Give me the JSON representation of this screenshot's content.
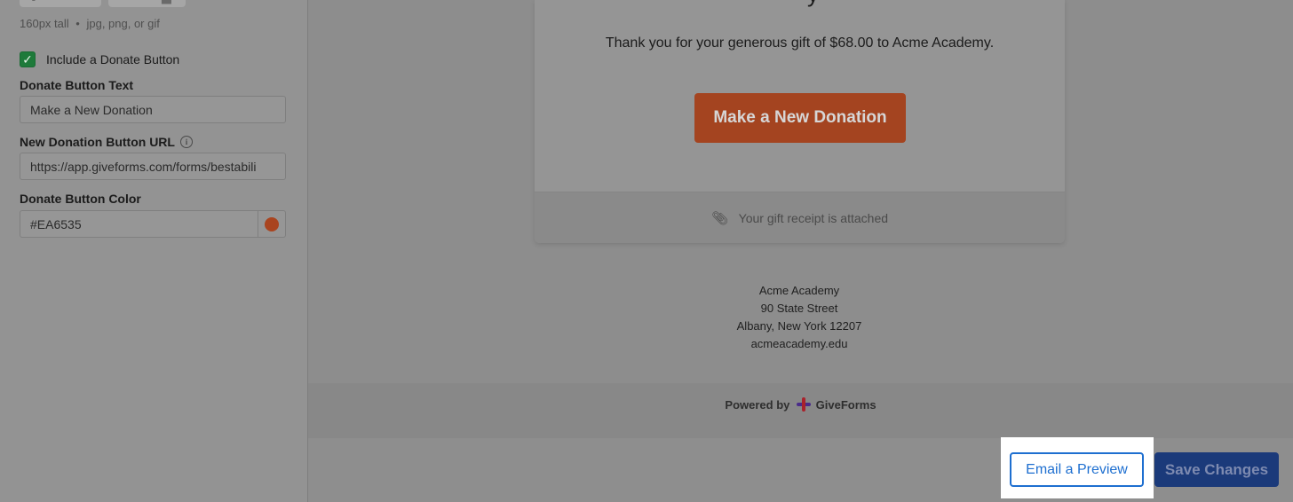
{
  "sidebar": {
    "image_hint_size": "160px tall",
    "image_hint_types": "jpg, png, or gif",
    "include_donate_checked": true,
    "include_donate_label": "Include a Donate Button",
    "donate_text_label": "Donate Button Text",
    "donate_text_value": "Make a New Donation",
    "donation_url_label": "New Donation Button URL",
    "donation_url_value": "https://app.giveforms.com/forms/bestabili",
    "donate_color_label": "Donate Button Color",
    "donate_color_value": "#EA6535"
  },
  "preview": {
    "heading_tail": "y",
    "thank_you_text": "Thank you for your generous gift of $68.00 to Acme Academy.",
    "donate_button_label": "Make a New Donation",
    "receipt_text": "Your gift receipt is attached",
    "org": {
      "name": "Acme Academy",
      "street": "90 State Street",
      "city": "Albany, New York 12207",
      "website": "acmeacademy.edu"
    },
    "powered_by_prefix": "Powered by",
    "powered_by_brand": "GiveForms"
  },
  "actions": {
    "email_preview_label": "Email a Preview",
    "save_changes_label": "Save Changes"
  },
  "colors": {
    "accent_blue": "#1E6FD0",
    "donate_button": "#EA6535",
    "check_green": "#2E9E4F"
  }
}
